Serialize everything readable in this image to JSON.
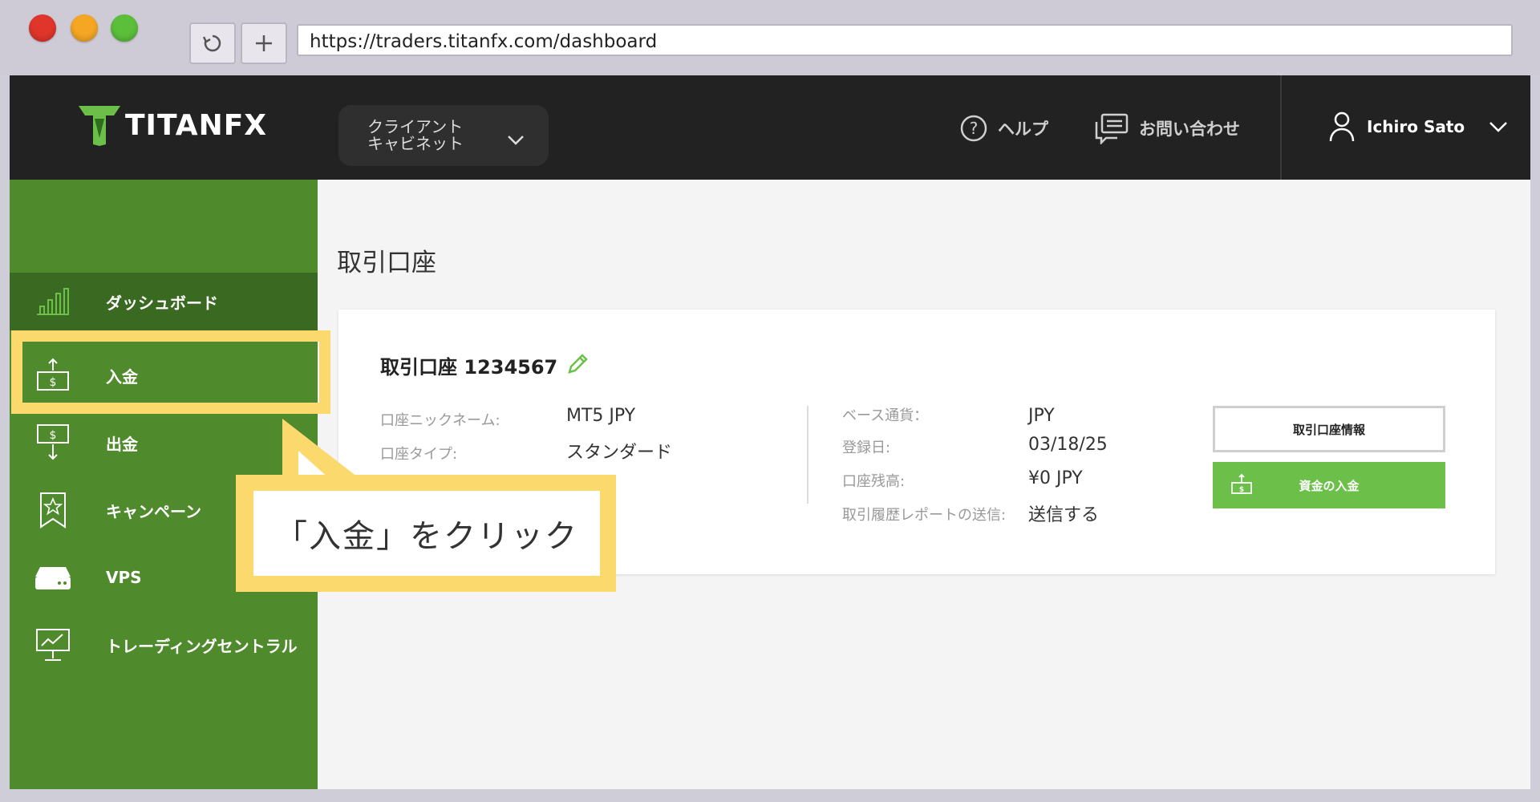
{
  "browser": {
    "url": "https://traders.titanfx.com/dashboard",
    "traffic_lights": [
      "#e0352b",
      "#f5a623",
      "#5bbf3a"
    ]
  },
  "header": {
    "logo_text": "TITANFX",
    "portal_label": "クライアント\nキャビネット",
    "help_label": "ヘルプ",
    "contact_label": "お問い合わせ",
    "user_name": "Ichiro Sato"
  },
  "sidebar": {
    "items": [
      {
        "label": "ダッシュボード",
        "icon": "bar-chart-icon"
      },
      {
        "label": "入金",
        "icon": "deposit-icon"
      },
      {
        "label": "出金",
        "icon": "withdraw-icon"
      },
      {
        "label": "キャンペーン",
        "icon": "ribbon-star-icon"
      },
      {
        "label": "VPS",
        "icon": "server-icon"
      },
      {
        "label": "トレーディングセントラル",
        "icon": "monitor-chart-icon"
      }
    ]
  },
  "main": {
    "title": "取引口座",
    "account": {
      "title": "取引口座 1234567",
      "fields_left": [
        {
          "label": "口座ニックネーム:",
          "value": "MT5 JPY"
        },
        {
          "label": "口座タイプ:",
          "value": "スタンダード"
        }
      ],
      "fields_right": [
        {
          "label": "ベース通貨：",
          "value": "JPY"
        },
        {
          "label": "登録日:",
          "value": "03/18/25"
        },
        {
          "label": "口座残高:",
          "value": "¥0 JPY"
        },
        {
          "label": "取引履歴レポートの送信:",
          "value": "送信する"
        }
      ],
      "info_button": "取引口座情報",
      "deposit_button": "資金の入金"
    }
  },
  "annotation": {
    "callout_text": "「入金」をクリック"
  },
  "colors": {
    "sidebar_green": "#4f8a2c",
    "accent_green": "#6cc04a",
    "highlight_yellow": "#fbd96d",
    "topbar": "#222222"
  }
}
